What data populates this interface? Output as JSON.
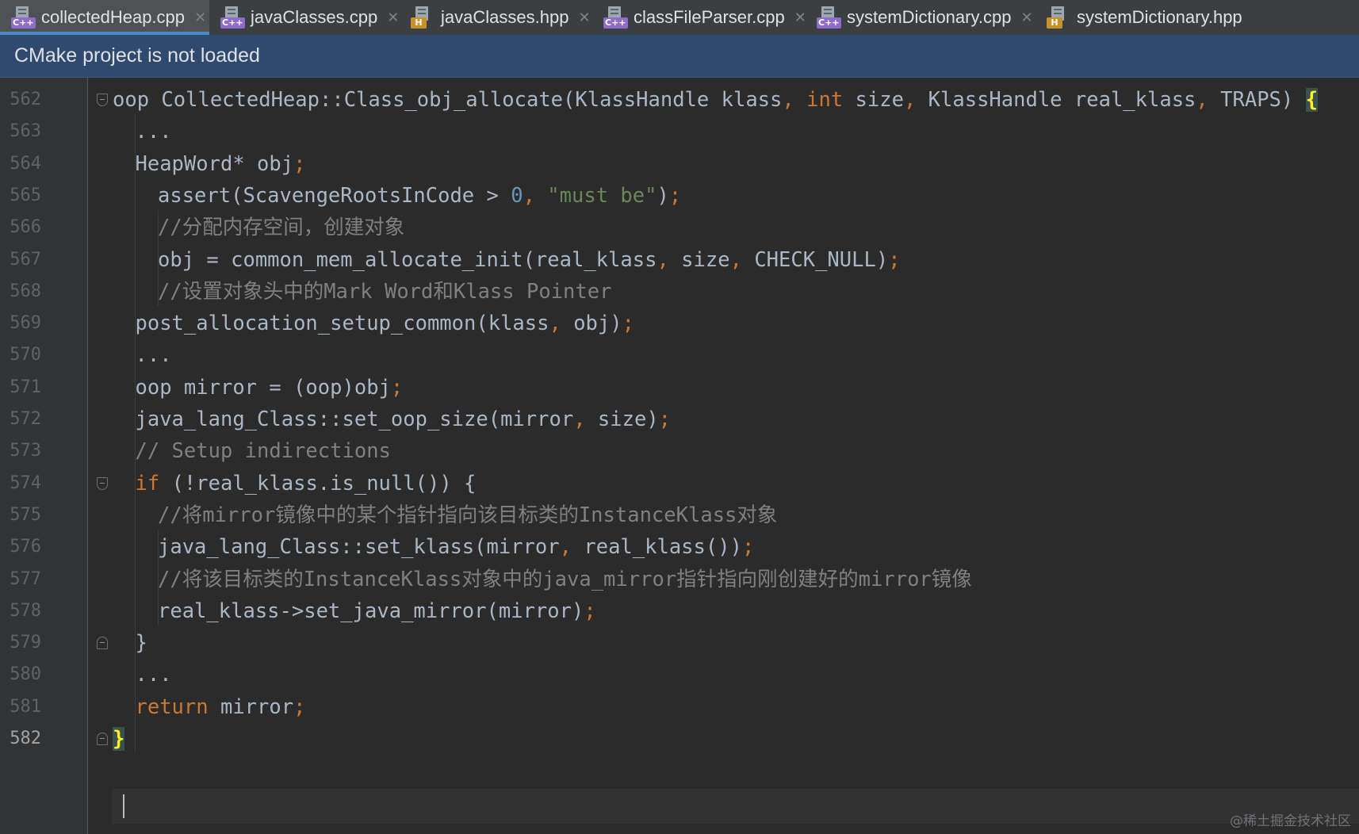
{
  "tabs": [
    {
      "label": "collectedHeap.cpp",
      "type": "C++",
      "active": true
    },
    {
      "label": "javaClasses.cpp",
      "type": "C++",
      "active": false
    },
    {
      "label": "javaClasses.hpp",
      "type": "H",
      "active": false
    },
    {
      "label": "classFileParser.cpp",
      "type": "C++",
      "active": false
    },
    {
      "label": "systemDictionary.cpp",
      "type": "C++",
      "active": false
    },
    {
      "label": "systemDictionary.hpp",
      "type": "H",
      "active": false
    }
  ],
  "banner": {
    "text": "CMake project is not loaded"
  },
  "editor": {
    "current_line": "582",
    "lines": [
      {
        "no": "562",
        "indent": 0,
        "fold": "open",
        "tokens": [
          {
            "t": "oop CollectedHeap::Class_obj_allocate(KlassHandle klass"
          },
          {
            "t": ", ",
            "c": "kw"
          },
          {
            "t": "int",
            "c": "kw"
          },
          {
            "t": " size"
          },
          {
            "t": ", ",
            "c": "kw"
          },
          {
            "t": "KlassHandle real_klass"
          },
          {
            "t": ", ",
            "c": "kw"
          },
          {
            "t": "TRAPS) "
          },
          {
            "t": "{",
            "c": "brace-hl"
          }
        ]
      },
      {
        "no": "563",
        "indent": 1,
        "tokens": [
          {
            "t": "..."
          }
        ]
      },
      {
        "no": "564",
        "indent": 1,
        "tokens": [
          {
            "t": "HeapWord* obj"
          },
          {
            "t": ";",
            "c": "kw"
          }
        ]
      },
      {
        "no": "565",
        "indent": 2,
        "tokens": [
          {
            "t": "assert(ScavengeRootsInCode > "
          },
          {
            "t": "0",
            "c": "num"
          },
          {
            "t": ", ",
            "c": "kw"
          },
          {
            "t": "\"must be\"",
            "c": "str"
          },
          {
            "t": ")"
          },
          {
            "t": ";",
            "c": "kw"
          }
        ]
      },
      {
        "no": "566",
        "indent": 2,
        "tokens": [
          {
            "t": "//分配内存空间，创建对象",
            "c": "cm"
          }
        ]
      },
      {
        "no": "567",
        "indent": 2,
        "tokens": [
          {
            "t": "obj = common_mem_allocate_init(real_klass"
          },
          {
            "t": ", ",
            "c": "kw"
          },
          {
            "t": "size"
          },
          {
            "t": ", ",
            "c": "kw"
          },
          {
            "t": "CHECK_NULL)"
          },
          {
            "t": ";",
            "c": "kw"
          }
        ]
      },
      {
        "no": "568",
        "indent": 2,
        "tokens": [
          {
            "t": "//设置对象头中的Mark Word和Klass Pointer",
            "c": "cm"
          }
        ]
      },
      {
        "no": "569",
        "indent": 1,
        "tokens": [
          {
            "t": "post_allocation_setup_common(klass"
          },
          {
            "t": ", ",
            "c": "kw"
          },
          {
            "t": "obj)"
          },
          {
            "t": ";",
            "c": "kw"
          }
        ]
      },
      {
        "no": "570",
        "indent": 1,
        "tokens": [
          {
            "t": "..."
          }
        ]
      },
      {
        "no": "571",
        "indent": 1,
        "tokens": [
          {
            "t": "oop mirror = (oop)obj"
          },
          {
            "t": ";",
            "c": "kw"
          }
        ]
      },
      {
        "no": "572",
        "indent": 1,
        "tokens": [
          {
            "t": "java_lang_Class::set_oop_size(mirror"
          },
          {
            "t": ", ",
            "c": "kw"
          },
          {
            "t": "size)"
          },
          {
            "t": ";",
            "c": "kw"
          }
        ]
      },
      {
        "no": "573",
        "indent": 1,
        "tokens": [
          {
            "t": "// Setup indirections",
            "c": "cm"
          }
        ]
      },
      {
        "no": "574",
        "indent": 1,
        "fold": "open",
        "tokens": [
          {
            "t": "if",
            "c": "kw"
          },
          {
            "t": " (!real_klass.is_null()) {"
          }
        ]
      },
      {
        "no": "575",
        "indent": 2,
        "tokens": [
          {
            "t": "//将mirror镜像中的某个指针指向该目标类的InstanceKlass对象",
            "c": "cm"
          }
        ]
      },
      {
        "no": "576",
        "indent": 2,
        "tokens": [
          {
            "t": "java_lang_Class::set_klass(mirror"
          },
          {
            "t": ", ",
            "c": "kw"
          },
          {
            "t": "real_klass())"
          },
          {
            "t": ";",
            "c": "kw"
          }
        ]
      },
      {
        "no": "577",
        "indent": 2,
        "tokens": [
          {
            "t": "//将该目标类的InstanceKlass对象中的java_mirror指针指向刚创建好的mirror镜像",
            "c": "cm"
          }
        ]
      },
      {
        "no": "578",
        "indent": 2,
        "tokens": [
          {
            "t": "real_klass->set_java_mirror(mirror)"
          },
          {
            "t": ";",
            "c": "kw"
          }
        ]
      },
      {
        "no": "579",
        "indent": 1,
        "fold": "close",
        "tokens": [
          {
            "t": "}"
          }
        ]
      },
      {
        "no": "580",
        "indent": 1,
        "tokens": [
          {
            "t": "..."
          }
        ]
      },
      {
        "no": "581",
        "indent": 1,
        "tokens": [
          {
            "t": "return",
            "c": "kw"
          },
          {
            "t": " mirror"
          },
          {
            "t": ";",
            "c": "kw"
          }
        ]
      },
      {
        "no": "582",
        "indent": 0,
        "fold": "close",
        "tokens": [
          {
            "t": "}",
            "c": "brace-hl"
          }
        ]
      }
    ]
  },
  "colors": {
    "background": "#2b2b2b",
    "keyword": "#cc7832",
    "number": "#6897bb",
    "string": "#6a8759",
    "comment": "#808080",
    "text": "#a9b7c6",
    "banner": "#2f4a6e"
  },
  "watermark": "@稀土掘金技术社区"
}
